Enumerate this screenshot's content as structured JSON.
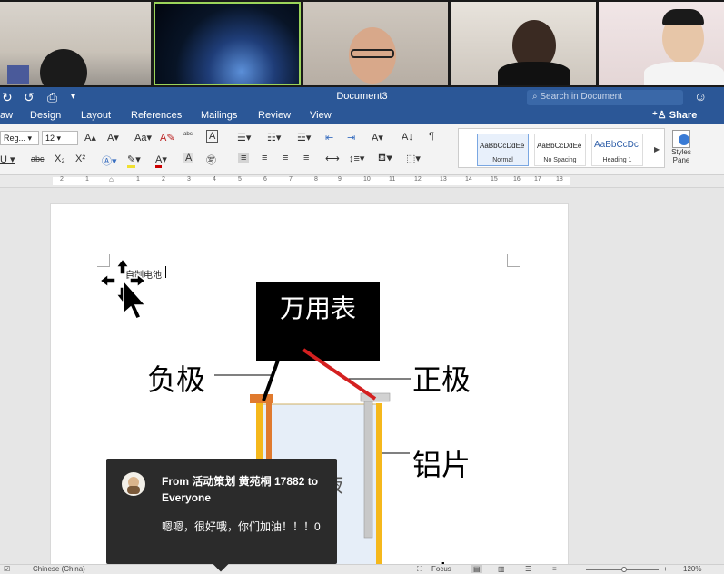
{
  "window": {
    "title": "Document3",
    "search_placeholder": "Search in Document",
    "share_label": "Share"
  },
  "tabs": [
    "aw",
    "Design",
    "Layout",
    "References",
    "Mailings",
    "Review",
    "View"
  ],
  "ribbon": {
    "font_name": "Reg...",
    "font_size": "12",
    "styles": [
      {
        "sample": "AaBbCcDdEe",
        "name": "Normal"
      },
      {
        "sample": "AaBbCcDdEe",
        "name": "No Spacing"
      },
      {
        "sample": "AaBbCcDc",
        "name": "Heading 1"
      }
    ],
    "styles_pane_label": "Styles Pane"
  },
  "ruler": {
    "numbers": [
      "2",
      "1",
      "1",
      "2",
      "3",
      "4",
      "5",
      "6",
      "7",
      "8",
      "9",
      "10",
      "11",
      "12",
      "13",
      "14",
      "15",
      "16",
      "17",
      "18"
    ]
  },
  "document": {
    "typed_text": "自制电池",
    "labels": {
      "meter": "万用表",
      "negative": "负极",
      "positive": "正极",
      "aluminum": "铝片",
      "partial_1": "液",
      "partial_2": "杯子"
    }
  },
  "chat": {
    "from_line": "From 活动策划 黄苑桐 17882 to Everyone",
    "message": "嗯嗯，很好哦，你们加油！！！0"
  },
  "statusbar": {
    "language": "Chinese (China)",
    "focus_label": "Focus",
    "zoom": "120%"
  },
  "colors": {
    "word_blue": "#2b5797",
    "negative_lead": "#000000",
    "positive_lead": "#d42020",
    "electrode_left": "#e07a2e",
    "electrode_frame": "#f5b81c",
    "electrode_right": "#c8c8c8"
  }
}
